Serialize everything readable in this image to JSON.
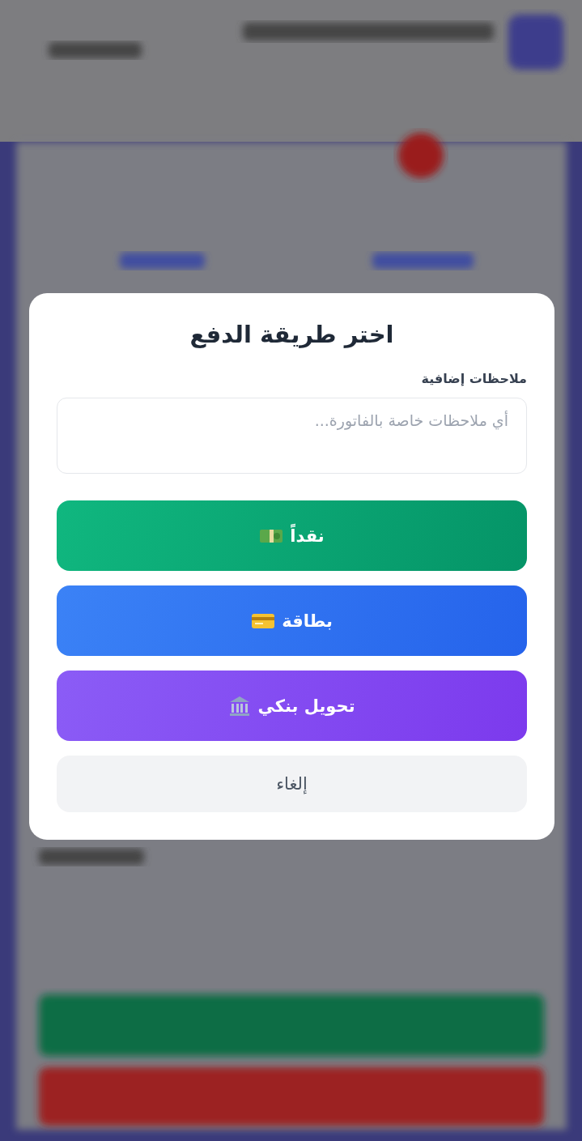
{
  "dialog": {
    "title": "اختر طريقة الدفع",
    "notes": {
      "label": "ملاحظات إضافية",
      "placeholder": "أي ملاحظات خاصة بالفاتورة..."
    },
    "buttons": [
      {
        "kind": "cash",
        "label": "نقداً"
      },
      {
        "kind": "card",
        "label": "بطاقة"
      },
      {
        "kind": "bank",
        "label": "تحويل بنكي"
      },
      {
        "kind": "cancel",
        "label": "إلغاء"
      }
    ]
  }
}
